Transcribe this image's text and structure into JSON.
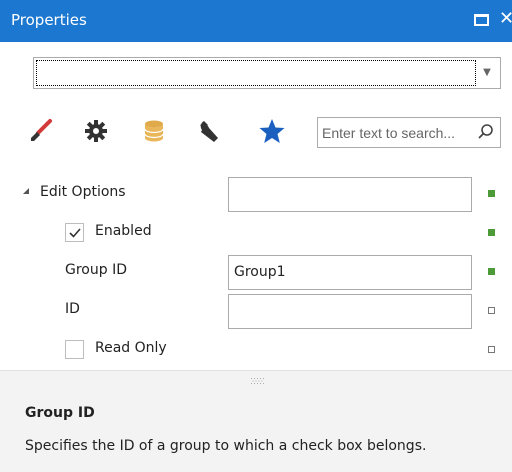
{
  "panel": {
    "title": "Properties"
  },
  "selector": {
    "value": ""
  },
  "toolbar": {
    "icons": [
      "brush-icon",
      "gear-icon",
      "database-icon",
      "wrench-icon",
      "star-icon"
    ],
    "search": {
      "placeholder": "Enter text to search..."
    }
  },
  "grid": {
    "category": {
      "label": "Edit Options",
      "value": ""
    },
    "rows": [
      {
        "label": "Enabled",
        "type": "checkbox",
        "checked": true,
        "modified": true
      },
      {
        "label": "Group ID",
        "type": "text",
        "value": "Group1",
        "modified": true
      },
      {
        "label": "ID",
        "type": "text",
        "value": "",
        "modified": false
      },
      {
        "label": "Read Only",
        "type": "checkbox",
        "checked": false,
        "modified": false
      }
    ]
  },
  "description": {
    "title": "Group ID",
    "text": "Specifies the ID of a group to which a check box belongs."
  },
  "colors": {
    "titlebar": "#1b77cf",
    "accent_blue": "#1b5fbf",
    "modified_marker": "#4d9b38"
  }
}
